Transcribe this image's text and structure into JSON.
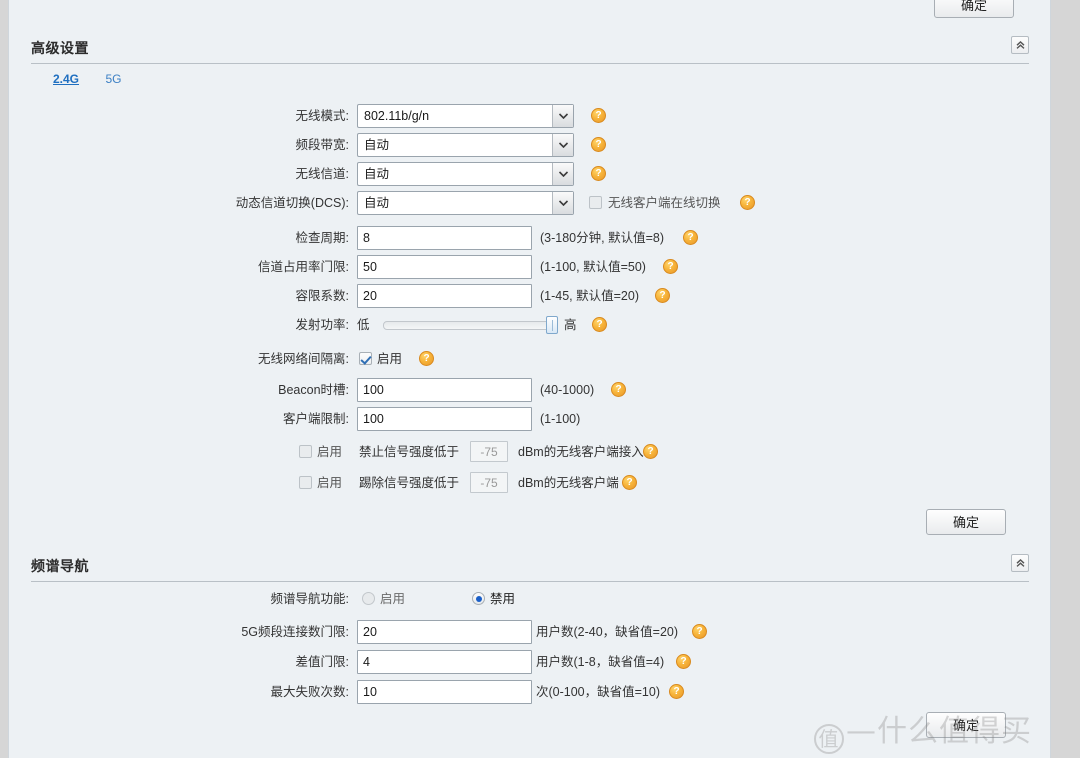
{
  "sections": {
    "advanced": {
      "title": "高级设置",
      "collapse_icon": "chevron-double-up-icon",
      "tabs": [
        {
          "label": "2.4G",
          "active": true
        },
        {
          "label": "5G",
          "active": false
        }
      ],
      "fields": {
        "wireless_mode": {
          "label": "无线模式:",
          "value": "802.11b/g/n",
          "help": "help-icon"
        },
        "band_width": {
          "label": "频段带宽:",
          "value": "自动",
          "help": "help-icon"
        },
        "channel": {
          "label": "无线信道:",
          "value": "自动",
          "help": "help-icon"
        },
        "dcs": {
          "label": "动态信道切换(DCS):",
          "value": "自动",
          "checkbox_label": "无线客户端在线切换",
          "checkbox_checked": false,
          "help": "help-icon"
        },
        "check_period": {
          "label": "检查周期:",
          "value": "8",
          "hint": "(3-180分钟, 默认值=8)",
          "help": "help-icon"
        },
        "channel_util": {
          "label": "信道占用率门限:",
          "value": "50",
          "hint": "(1-100, 默认值=50)",
          "help": "help-icon"
        },
        "tolerance": {
          "label": "容限系数:",
          "value": "20",
          "hint": "(1-45, 默认值=20)",
          "help": "help-icon"
        },
        "tx_power": {
          "label": "发射功率:",
          "low": "低",
          "high": "高",
          "value": 100,
          "help": "help-icon"
        },
        "isolation": {
          "label": "无线网络间隔离:",
          "checkbox_label": "启用",
          "checked": true,
          "help": "help-icon"
        },
        "beacon": {
          "label": "Beacon时槽:",
          "value": "100",
          "hint": "(40-1000)",
          "help": "help-icon"
        },
        "client_limit": {
          "label": "客户端限制:",
          "value": "100",
          "hint": "(1-100)"
        },
        "deny_weak": {
          "checkbox_label": "启用",
          "checked": false,
          "text_before": "禁止信号强度低于",
          "value": "-75",
          "text_after": "dBm的无线客户端接入",
          "help": "help-icon"
        },
        "kick_weak": {
          "checkbox_label": "启用",
          "checked": false,
          "text_before": "踢除信号强度低于",
          "value": "-75",
          "text_after": "dBm的无线客户端",
          "help": "help-icon"
        }
      },
      "ok_button": "确定"
    },
    "spectrum": {
      "title": "频谱导航",
      "collapse_icon": "chevron-double-up-icon",
      "fields": {
        "feature": {
          "label": "频谱导航功能:",
          "options": [
            {
              "label": "启用",
              "selected": false
            },
            {
              "label": "禁用",
              "selected": true
            }
          ]
        },
        "conn_threshold": {
          "label": "5G频段连接数门限:",
          "value": "20",
          "hint": "用户数(2-40，缺省值=20)",
          "help": "help-icon"
        },
        "diff_threshold": {
          "label": "差值门限:",
          "value": "4",
          "hint": "用户数(1-8，缺省值=4)",
          "help": "help-icon"
        },
        "max_fail": {
          "label": "最大失败次数:",
          "value": "10",
          "hint": "次(0-100，缺省值=10)",
          "help": "help-icon"
        }
      },
      "ok_button": "确定"
    }
  },
  "top_ok_button": "确定",
  "watermark": {
    "circle": "值",
    "text": "—什么值得买"
  }
}
